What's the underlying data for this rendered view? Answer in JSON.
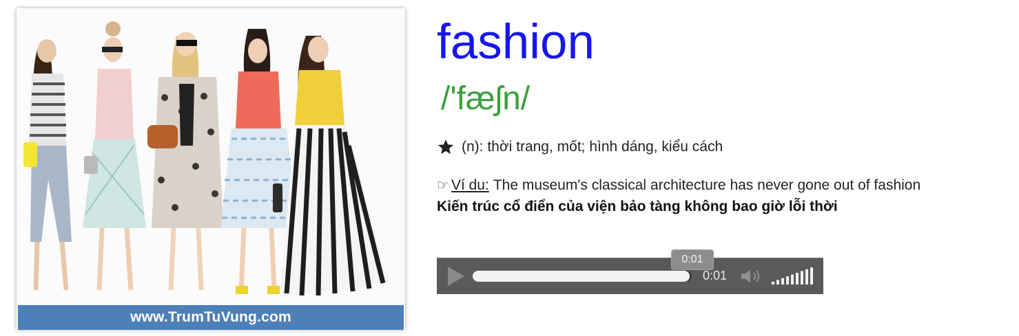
{
  "image": {
    "watermark": "www.TrumTuVung.com"
  },
  "entry": {
    "word": "fashion",
    "phonetic": "/'fæʃn/",
    "meaning": "(n): thời trang, mốt; hình dáng, kiểu cách",
    "example_label": "Ví du:",
    "example_text": "The museum's classical architecture has never gone out of fashion",
    "translation": "Kiến trúc cổ điển của viện bảo tàng không bao giờ lỗi thời"
  },
  "player": {
    "current_time": "0:01",
    "tooltip_time": "0:01",
    "progress": 0.99,
    "volume_level": 1.0
  },
  "icons": [
    "star-icon",
    "pointing-hand-icon",
    "play-icon",
    "volume-icon",
    "volume-level-icon"
  ],
  "colors": {
    "word": "#1717e8",
    "phonetic": "#3c9f3c",
    "watermark_bg": "#4d7fb8",
    "player_bg": "#5a5a5a"
  }
}
